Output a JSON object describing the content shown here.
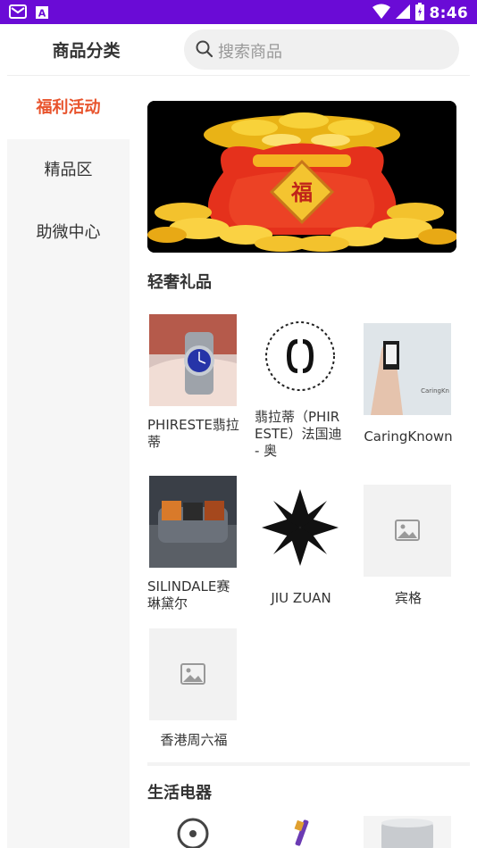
{
  "status_bar": {
    "time": "8:46",
    "left_icons": [
      "mail-icon",
      "a-badge-icon"
    ],
    "right_icons": [
      "wifi-icon",
      "signal-icon",
      "battery-icon"
    ]
  },
  "header": {
    "title": "商品分类",
    "search_placeholder": "搜索商品"
  },
  "sidebar": {
    "items": [
      {
        "label": "福利活动",
        "active": true
      },
      {
        "label": "精品区",
        "active": false
      },
      {
        "label": "助微中心",
        "active": false
      }
    ]
  },
  "content": {
    "banner": {
      "badge_text": "福",
      "image_desc": "lucky-money-bag"
    },
    "sections": [
      {
        "title": "轻奢礼品",
        "items": [
          {
            "label": "PHIRESTE翡拉蒂",
            "thumb": "watch-photo"
          },
          {
            "label": "翡拉蒂（PHIRESTE）法国迪 - 奥",
            "thumb": "dior-logo"
          },
          {
            "label": "CaringKnown",
            "thumb": "hand-watch-photo"
          },
          {
            "label": "SILINDALE赛琳黛尔",
            "thumb": "bags-photo"
          },
          {
            "label": "JIU ZUAN",
            "thumb": "star-logo"
          },
          {
            "label": "宾格",
            "thumb": "placeholder"
          },
          {
            "label": "香港周六福",
            "thumb": "placeholder"
          }
        ]
      },
      {
        "title": "生活电器",
        "items": []
      }
    ]
  },
  "colors": {
    "status_bar": "#6a0bd6",
    "accent": "#e8542d",
    "sidebar_bg": "#f6f6f6"
  }
}
